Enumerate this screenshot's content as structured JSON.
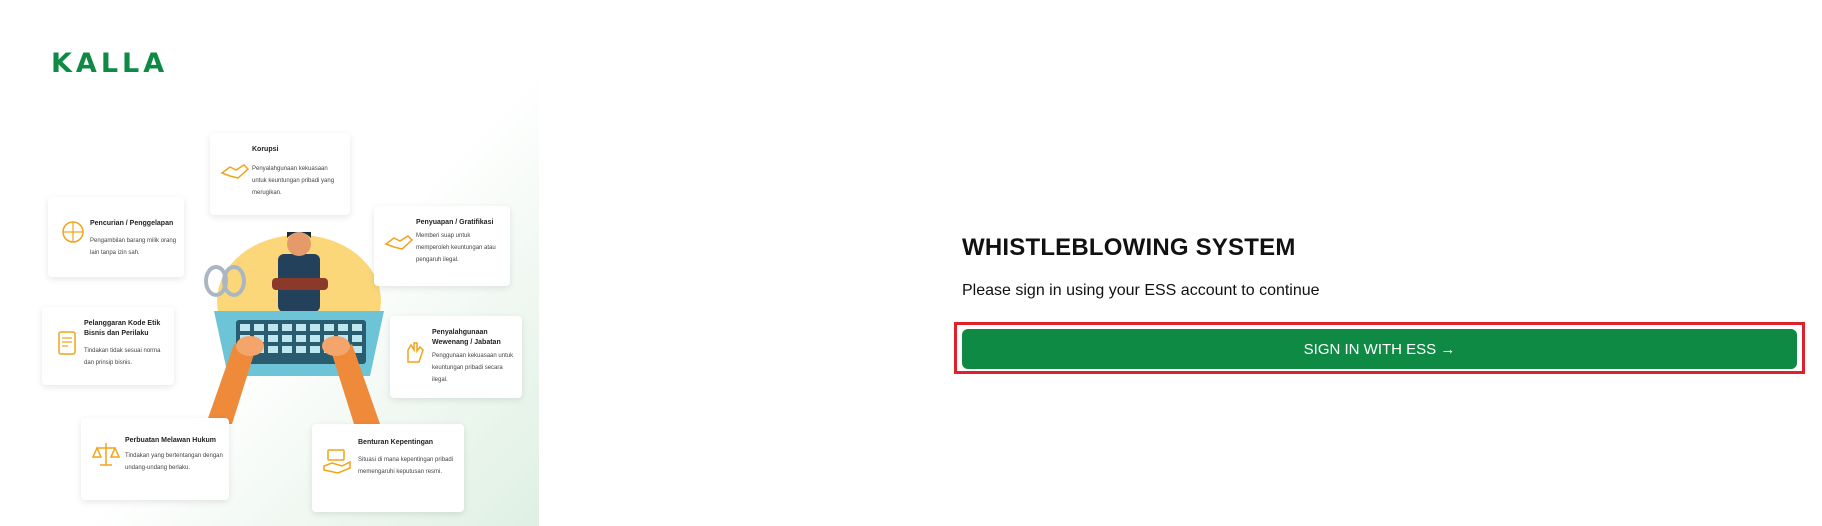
{
  "brand": {
    "logo_text": "KALLA"
  },
  "hero": {
    "cards": [
      {
        "title": "Korupsi",
        "description": "Penyalahgunaan kekuasaan untuk keuntungan pribadi yang merugikan.",
        "icon": "handshake-icon"
      },
      {
        "title": "Pencurian / Penggelapan",
        "description": "Pengambilan barang milik orang lain tanpa izin sah.",
        "icon": "globe-hand-icon"
      },
      {
        "title": "Penyuapan / Gratifikasi",
        "description": "Memberi suap untuk memperoleh keuntungan atau pengaruh ilegal.",
        "icon": "handshake-icon"
      },
      {
        "title": "Pelanggaran Kode Etik Bisnis dan Perilaku",
        "description": "Tindakan tidak sesuai norma dan prinsip bisnis.",
        "icon": "document-icon"
      },
      {
        "title": "Penyalahgunaan Wewenang / Jabatan",
        "description": "Penggunaan kekuasaan untuk keuntungan pribadi secara ilegal.",
        "icon": "hand-icon"
      },
      {
        "title": "Perbuatan Melawan Hukum",
        "description": "Tindakan yang bertentangan dengan undang-undang berlaku.",
        "icon": "scales-icon"
      },
      {
        "title": "Benturan Kepentingan",
        "description": "Situasi di mana kepentingan pribadi memengaruhi keputusan resmi.",
        "icon": "money-hand-icon"
      }
    ]
  },
  "login": {
    "title": "WHISTLEBLOWING SYSTEM",
    "subtitle": "Please sign in using your ESS account to continue",
    "button_label": "SIGN IN WITH ESS →"
  },
  "colors": {
    "primary": "#0f8a45",
    "highlight": "#e0202a",
    "accent": "#f2a31a"
  }
}
